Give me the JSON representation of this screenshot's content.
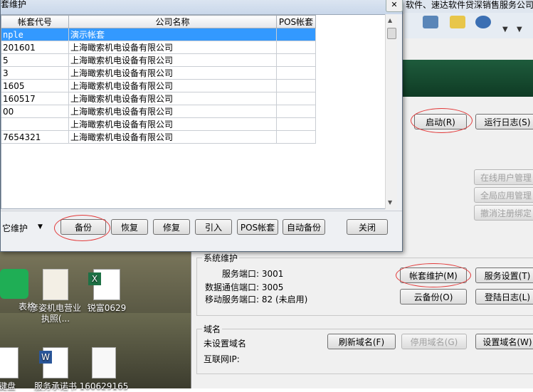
{
  "back_window": {
    "title_fragment": "软件、速达软件贷深销售服务公司",
    "start_button": "启动(R)",
    "run_log_button": "运行日志(S)",
    "online_users_button": "在线用户管理",
    "global_app_button": "全局应用管理",
    "cancel_register_button": "撤消注册绑定",
    "system_group": {
      "title": "系统维护",
      "service_port_label": "服务端口: 3001",
      "data_port_label": "数据通信端口: 3005",
      "mobile_port_label": "移动服务端口: 82 (未启用)",
      "account_maint_button": "帐套维护(M)",
      "service_settings_button": "服务设置(T)",
      "cloud_backup_button": "云备份(O)",
      "login_log_button": "登陆日志(L)"
    },
    "domain_group": {
      "title": "域名",
      "status": "未设置域名",
      "ip_label": "互联网IP:",
      "refresh_button": "刷新域名(F)",
      "disable_button": "停用域名(G)",
      "set_button": "设置域名(W)"
    }
  },
  "dialog": {
    "title": "套维护",
    "columns": [
      "帐套代号",
      "公司名称",
      "POS帐套"
    ],
    "rows": [
      {
        "code": "nple",
        "name": "演示帐套",
        "pos": ""
      },
      {
        "code": "201601",
        "name": "上海瞰索机电设备有限公司",
        "pos": ""
      },
      {
        "code": "5",
        "name": "上海瞰索机电设备有限公司",
        "pos": ""
      },
      {
        "code": "3",
        "name": "上海瞰索机电设备有限公司",
        "pos": ""
      },
      {
        "code": "1605",
        "name": "上海瞰索机电设备有限公司",
        "pos": ""
      },
      {
        "code": "160517",
        "name": "上海瞰索机电设备有限公司",
        "pos": ""
      },
      {
        "code": "00",
        "name": "上海瞰索机电设备有限公司",
        "pos": ""
      },
      {
        "code": "",
        "name": "上海瞰索机电设备有限公司",
        "pos": ""
      },
      {
        "code": "7654321",
        "name": "上海瞰索机电设备有限公司",
        "pos": ""
      }
    ],
    "other_maint_label": "它维护",
    "buttons": {
      "backup": "备份",
      "restore": "恢复",
      "repair": "修复",
      "import": "引入",
      "pos_account": "POS帐套",
      "auto_backup": "自动备份",
      "close": "关闭"
    }
  },
  "desktop_icons": [
    {
      "label": "表格",
      "icon": "spreadsheet-app-icon"
    },
    {
      "label": "彦姿机电营业执照(...",
      "icon": "license-image-icon"
    },
    {
      "label": "锐富0629",
      "icon": "excel-file-icon"
    },
    {
      "label": "键盘",
      "icon": "file-icon"
    },
    {
      "label": "服务承诺书",
      "icon": "word-file-icon"
    },
    {
      "label": "160629165",
      "icon": "document-image-icon"
    }
  ],
  "colors": {
    "selection": "#3399ff",
    "highlight_circle": "#e23a3a",
    "header_band": "#1e5b3c"
  }
}
